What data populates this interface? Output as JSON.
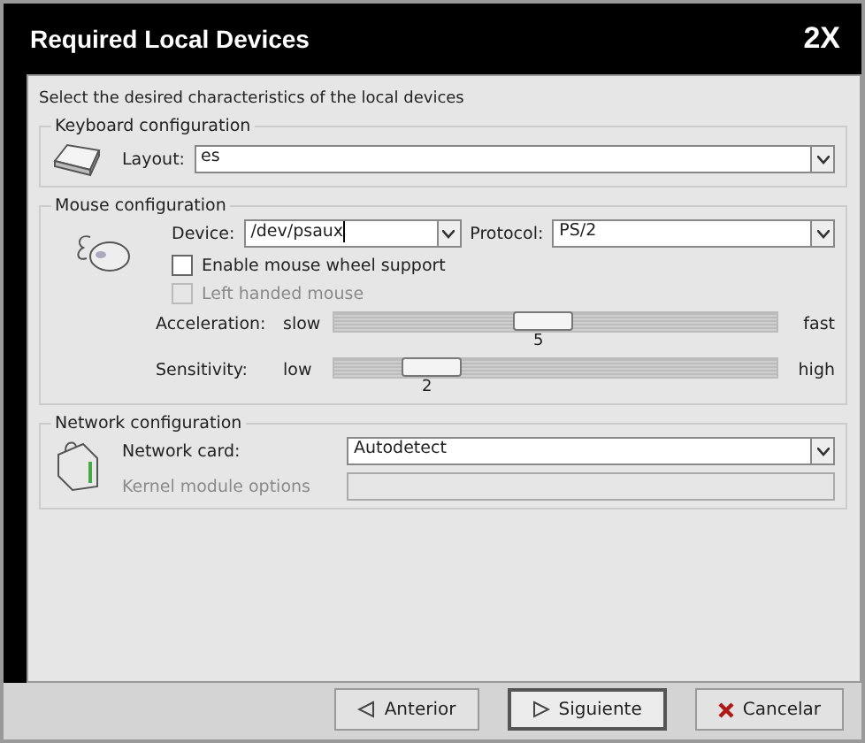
{
  "window": {
    "title": "Required Local Devices",
    "logo": "2X"
  },
  "intro": "Select the desired characteristics of the local devices",
  "keyboard": {
    "title": "Keyboard configuration",
    "layout": {
      "label": "Layout:",
      "value": "es"
    }
  },
  "mouse": {
    "title": "Mouse configuration",
    "device": {
      "label": "Device:",
      "value": "/dev/psaux"
    },
    "protocol": {
      "label": "Protocol:",
      "value": "PS/2"
    },
    "checkboxes": [
      {
        "label": "Enable mouse wheel support",
        "checked": false,
        "disabled": false
      },
      {
        "label": "Left handed mouse",
        "checked": false,
        "disabled": true
      }
    ],
    "sliders": [
      {
        "label": "Acceleration:",
        "min_label": "slow",
        "max_label": "fast",
        "level": 0.47,
        "reading": "5"
      },
      {
        "label": "Sensitivity:",
        "min_label": "low",
        "max_label": "high",
        "level": 0.22,
        "reading": "2"
      }
    ]
  },
  "network": {
    "title": "Network configuration",
    "card": {
      "label": "Network card:",
      "value": "Autodetect"
    },
    "kernel": {
      "label": "Kernel module options",
      "disabled": true
    }
  },
  "buttons": [
    {
      "kind": "back",
      "label": "Anterior",
      "default": false
    },
    {
      "kind": "next",
      "label": "Siguiente",
      "default": true
    },
    {
      "kind": "cancel",
      "label": "Cancelar",
      "default": false
    }
  ]
}
